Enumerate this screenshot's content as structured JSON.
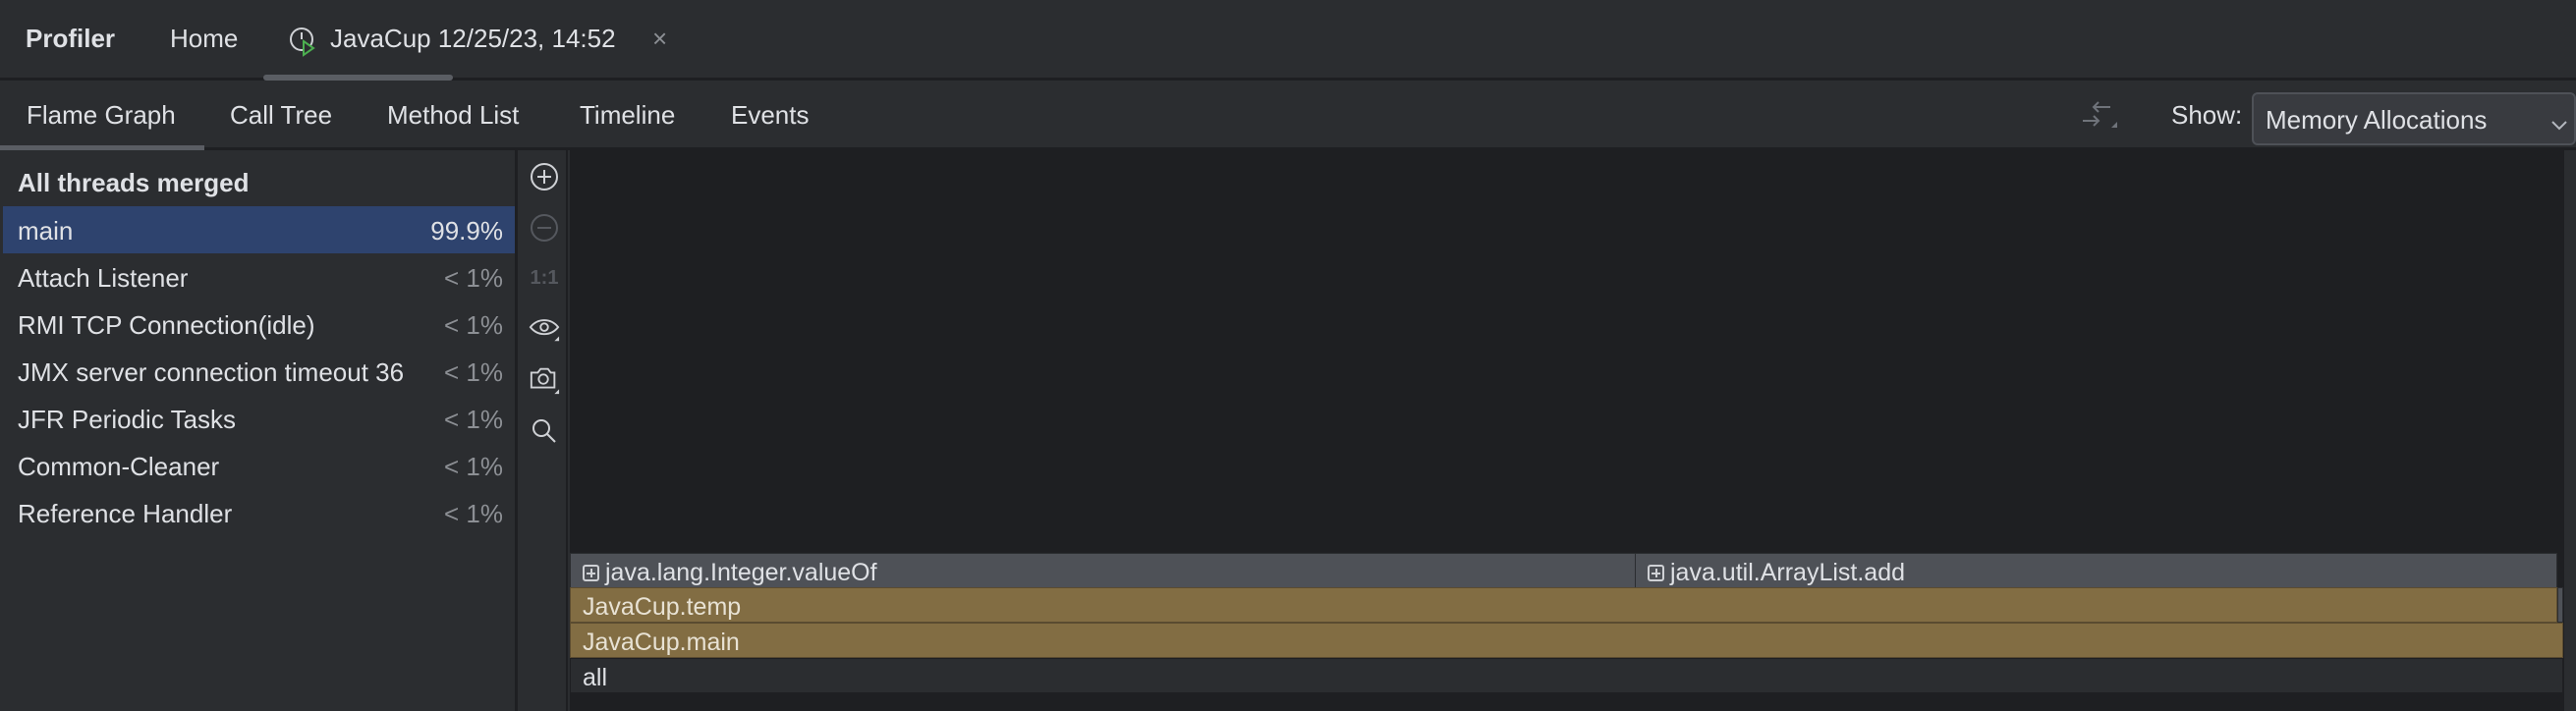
{
  "header": {
    "app_title": "Profiler",
    "home_tab": "Home",
    "session_tab": "JavaCup 12/25/23, 14:52",
    "close_glyph": "×",
    "session_icon": "clock-run-icon"
  },
  "view_tabs": [
    {
      "label": "Flame Graph",
      "active": true
    },
    {
      "label": "Call Tree"
    },
    {
      "label": "Method List"
    },
    {
      "label": "Timeline"
    },
    {
      "label": "Events"
    }
  ],
  "show": {
    "label": "Show:",
    "selected": "Memory Allocations"
  },
  "threads": {
    "header": "All threads merged",
    "items": [
      {
        "name": "main",
        "percent": "99.9%",
        "selected": true
      },
      {
        "name": "Attach Listener",
        "percent": "< 1%"
      },
      {
        "name": "RMI TCP Connection(idle)",
        "percent": "< 1%"
      },
      {
        "name": "JMX server connection timeout 36",
        "percent": "< 1%"
      },
      {
        "name": "JFR Periodic Tasks",
        "percent": "< 1%"
      },
      {
        "name": "Common-Cleaner",
        "percent": "< 1%"
      },
      {
        "name": "Reference Handler",
        "percent": "< 1%"
      }
    ]
  },
  "toolbar": {
    "reset_zoom": "1:1"
  },
  "flame": {
    "frames": [
      {
        "label": "java.lang.Integer.valueOf",
        "collapsed": true
      },
      {
        "label": "java.util.ArrayList.add",
        "collapsed": true
      },
      {
        "label": "JavaCup.temp"
      },
      {
        "label": "JavaCup.main"
      },
      {
        "label": "all"
      }
    ]
  },
  "colors": {
    "selection": "#2e436e",
    "frame_gold": "#826d43",
    "frame_gray": "#4e5157",
    "background": "#1e1f22"
  }
}
